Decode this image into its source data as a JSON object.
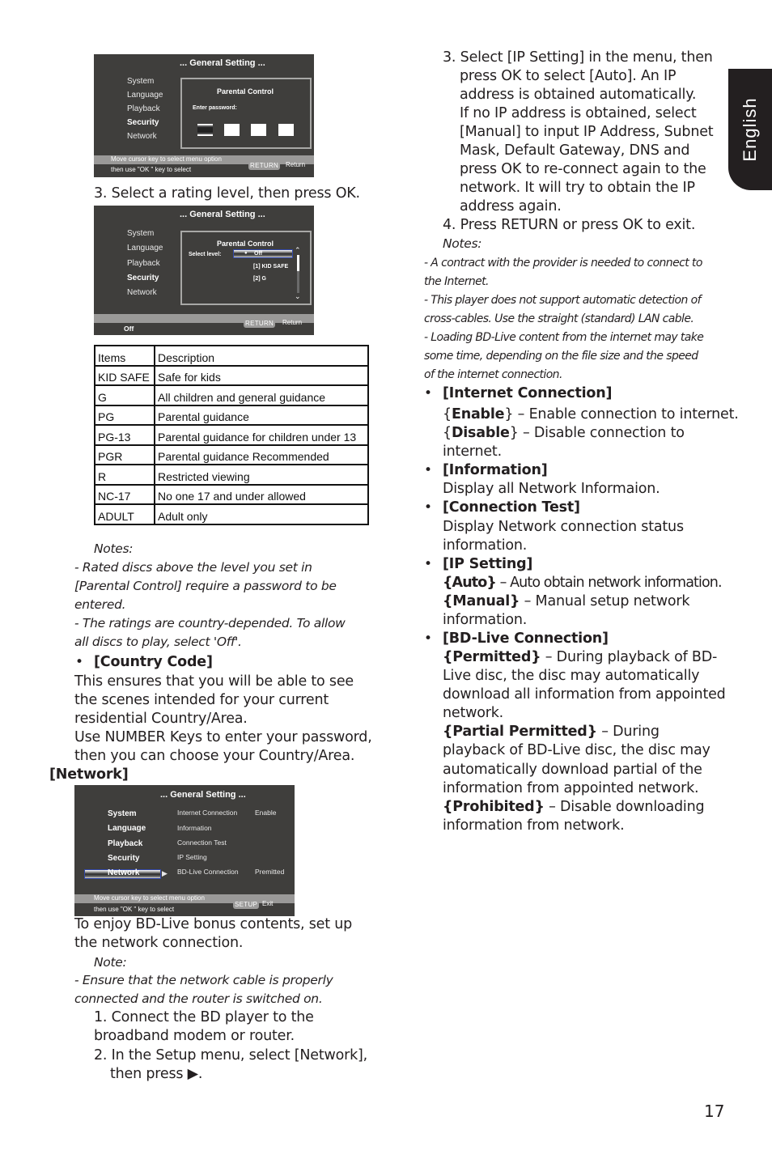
{
  "side_tab": {
    "label": "English"
  },
  "page_number": "17",
  "osd_password": {
    "title": "... General Setting ...",
    "menu": [
      "System",
      "Language",
      "Playback",
      "Security",
      "Network"
    ],
    "active_menu": "Security",
    "panel_title": "Parental Control",
    "prompt": "Enter password:",
    "hint_line1": "Move cursor key to select menu option",
    "hint_line2": "then use \"OK \" key to select",
    "key": "RETURN",
    "key_label": "Return"
  },
  "step3_rating": "3. Select a rating level, then press OK.",
  "osd_level": {
    "title": "... General Setting ...",
    "menu": [
      "System",
      "Language",
      "Playback",
      "Security",
      "Network"
    ],
    "panel_title": "Parental Control",
    "select_label": "Select level:",
    "options": [
      "Off",
      "[1] KID SAFE",
      "[2] G"
    ],
    "selected_option": "Off",
    "status": "Off",
    "key": "RETURN",
    "key_label": "Return"
  },
  "ratings_table": {
    "headers": [
      "Items",
      "Description"
    ],
    "rows": [
      [
        "KID SAFE",
        "Safe for kids"
      ],
      [
        "G",
        "All children and general guidance"
      ],
      [
        "PG",
        "Parental guidance"
      ],
      [
        "PG-13",
        "Parental guidance for children under 13"
      ],
      [
        "PGR",
        "Parental guidance Recommended"
      ],
      [
        "R",
        "Restricted viewing"
      ],
      [
        "NC-17",
        "No one 17 and under allowed"
      ],
      [
        "ADULT",
        "Adult only"
      ]
    ]
  },
  "left_notes": {
    "heading": "Notes:",
    "lines": [
      "- Rated discs above the level you set in",
      "[Parental Control] require a password to be",
      "entered.",
      "- The ratings are country-depended. To allow",
      "all discs to play, select 'Off'."
    ]
  },
  "country_code": {
    "bullet": "•",
    "heading": "[Country Code]",
    "lines": [
      "This ensures that you will be able to see",
      "the scenes intended for your current",
      "residential  Country/Area.",
      "Use NUMBER Keys to enter your password,",
      "then you can choose your Country/Area."
    ]
  },
  "network_heading": "[Network]",
  "osd_network": {
    "title": "... General Setting ...",
    "menu": [
      "System",
      "Language",
      "Playback",
      "Security",
      "Network"
    ],
    "active_menu": "Network",
    "items": [
      {
        "label": "Internet Connection",
        "value": "Enable"
      },
      {
        "label": "Information",
        "value": ""
      },
      {
        "label": "Connection Test",
        "value": ""
      },
      {
        "label": "IP Setting",
        "value": ""
      },
      {
        "label": "BD-Live Connection",
        "value": "Premitted"
      }
    ],
    "hint_line1": "Move cursor key to select menu option",
    "hint_line2": "then use \"OK \" key to select",
    "key": "SETUP",
    "key_label": "Exit"
  },
  "network_intro": {
    "lines": [
      "To enjoy BD-Live bonus contents, set up",
      "the network connection."
    ],
    "note_heading": "Note:",
    "note_lines": [
      "- Ensure that the network cable is properly",
      "connected and the router is switched on."
    ],
    "steps": [
      "1. Connect the BD player to the",
      "broadband modem or router.",
      "2. In the Setup menu, select [Network],",
      "then press ▶."
    ]
  },
  "right_steps": {
    "lines": [
      "3. Select [IP Setting] in the menu, then",
      "press OK to select [Auto]. An IP",
      "address is obtained automatically.",
      "If no IP address is obtained, select",
      "[Manual] to input IP Address, Subnet",
      "Mask, Default Gateway, DNS and",
      "press OK to re-connect again to the",
      "network. It will try to obtain the IP",
      "address again.",
      "4. Press RETURN or press OK to exit."
    ],
    "notes_heading": "Notes:",
    "notes": [
      " - A contract with the provider is needed to connect to",
      "the Internet.",
      "- This player does not support automatic detection of",
      "cross-cables. Use the straight (standard) LAN cable.",
      "- Loading BD-Live content from the internet may take",
      "some time, depending on the file size and the speed",
      "of the internet connection."
    ]
  },
  "options": {
    "bullet": "•",
    "internet_connection": {
      "heading": "[Internet Connection]",
      "enable_key": "Enable",
      "enable_desc": " – Enable connection to internet.",
      "disable_key": "Disable",
      "disable_desc": " – Disable connection to",
      "disable_cont": "internet."
    },
    "information": {
      "heading": "[Information]",
      "desc": "Display all Network Informaion."
    },
    "connection_test": {
      "heading": "[Connection Test]",
      "desc1": "Display Network connection status",
      "desc2": "information."
    },
    "ip_setting": {
      "heading": "[IP Setting]",
      "auto_key": "{Auto}",
      "auto_desc": " – Auto obtain network information.",
      "manual_key": "{Manual}",
      "manual_desc": " – Manual setup network",
      "manual_cont": "information."
    },
    "bd_live": {
      "heading": "[BD-Live Connection]",
      "permitted_key": "{Permitted}",
      "permitted_desc": " – During playback of BD-",
      "permitted_lines": [
        "Live disc, the disc may automatically",
        "download all information from appointed",
        "network."
      ],
      "partial_key": "{Partial Permitted}",
      "partial_desc": " – During",
      "partial_lines": [
        "playback of BD-Live disc, the disc may",
        "automatically download partial of the",
        "information from appointed network."
      ],
      "prohibited_key": "{Prohibited}",
      "prohibited_desc": " – Disable downloading",
      "prohibited_lines": [
        "information from network."
      ]
    }
  }
}
